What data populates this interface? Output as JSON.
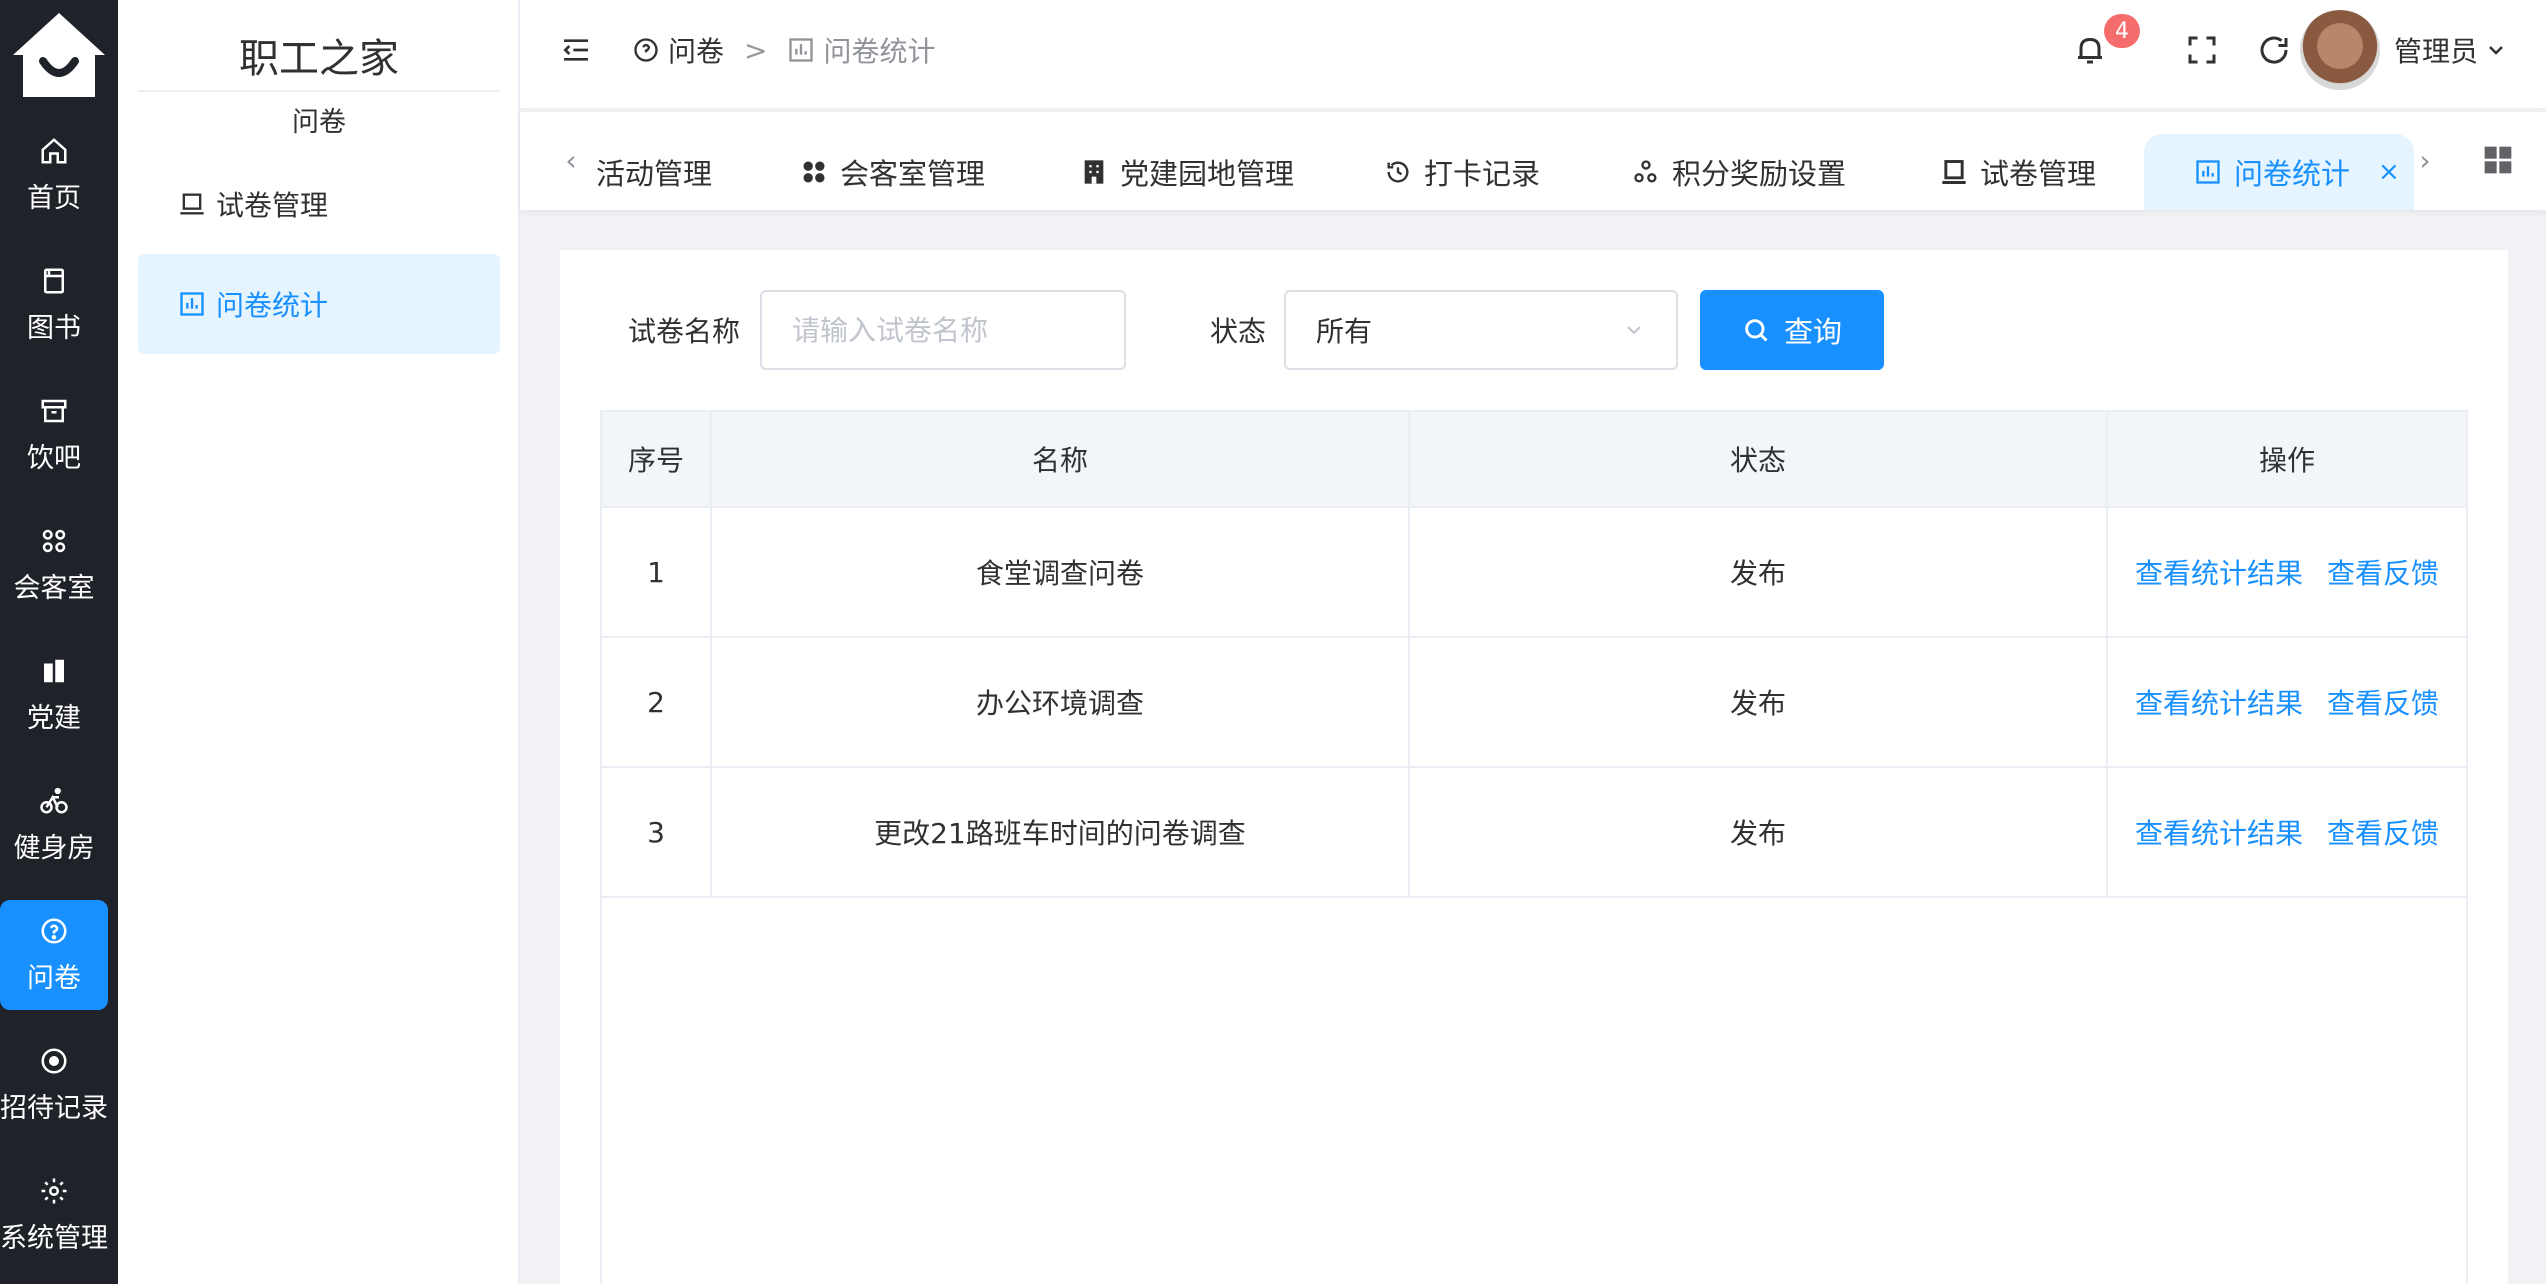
{
  "rail": {
    "items": [
      {
        "label": "首页",
        "icon": "home-icon"
      },
      {
        "label": "图书",
        "icon": "book-icon"
      },
      {
        "label": "饮吧",
        "icon": "archive-icon"
      },
      {
        "label": "会客室",
        "icon": "command-icon"
      },
      {
        "label": "党建",
        "icon": "building-icon"
      },
      {
        "label": "健身房",
        "icon": "bike-icon"
      },
      {
        "label": "问卷",
        "icon": "question-circle-icon"
      },
      {
        "label": "招待记录",
        "icon": "target-icon"
      },
      {
        "label": "系统管理",
        "icon": "gear-icon"
      }
    ]
  },
  "side": {
    "title": "职工之家",
    "subtitle": "问卷",
    "items": [
      {
        "label": "试卷管理"
      },
      {
        "label": "问卷统计"
      }
    ]
  },
  "header": {
    "breadcrumb": [
      "问卷",
      "问卷统计"
    ],
    "separator": ">",
    "notification_count": "4",
    "user_name": "管理员"
  },
  "tabs": [
    {
      "label": "活动管理"
    },
    {
      "label": "会客室管理"
    },
    {
      "label": "党建园地管理"
    },
    {
      "label": "打卡记录"
    },
    {
      "label": "积分奖励设置"
    },
    {
      "label": "试卷管理"
    },
    {
      "label": "问卷统计",
      "close": "×"
    }
  ],
  "filter": {
    "name_label": "试卷名称",
    "name_placeholder": "请输入试卷名称",
    "status_label": "状态",
    "status_value": "所有",
    "query_label": "查询"
  },
  "table": {
    "headers": [
      "序号",
      "名称",
      "状态",
      "操作"
    ],
    "rows": [
      {
        "no": "1",
        "name": "食堂调查问卷",
        "status": "发布"
      },
      {
        "no": "2",
        "name": "办公环境调查",
        "status": "发布"
      },
      {
        "no": "3",
        "name": "更改21路班车时间的问卷调查",
        "status": "发布"
      }
    ],
    "actions": [
      "查看统计结果",
      "查看反馈"
    ]
  },
  "colors": {
    "accent": "#1890ff",
    "rail_bg": "#1f2329",
    "badge": "#f56c6c"
  }
}
